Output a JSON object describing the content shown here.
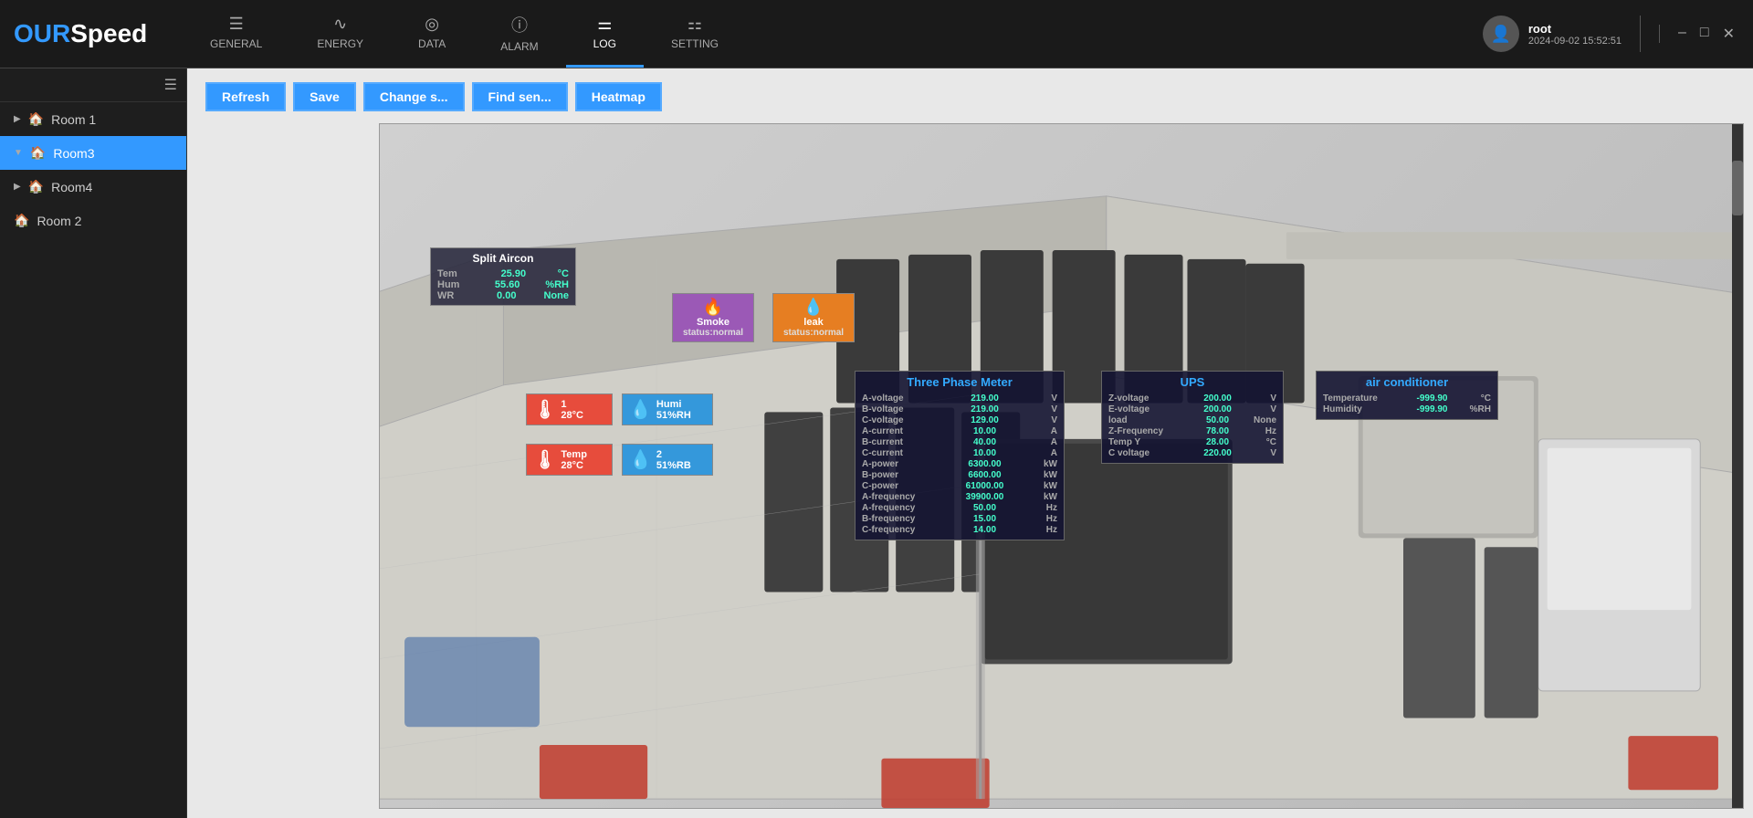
{
  "app": {
    "logo_our": "OUR",
    "logo_speed": "Speed"
  },
  "nav": {
    "items": [
      {
        "id": "general",
        "icon": "☰",
        "label": "GENERAL",
        "active": false
      },
      {
        "id": "energy",
        "icon": "∿",
        "label": "ENERGY",
        "active": false
      },
      {
        "id": "data",
        "icon": "◎",
        "label": "DATA",
        "active": false
      },
      {
        "id": "alarm",
        "icon": "ⓘ",
        "label": "ALARM",
        "active": false
      },
      {
        "id": "log",
        "icon": "⚌",
        "label": "LOG",
        "active": true
      },
      {
        "id": "setting",
        "icon": "⚏",
        "label": "SETTING",
        "active": false
      }
    ]
  },
  "user": {
    "name": "root",
    "datetime": "2024-09-02 15:52:51"
  },
  "toolbar": {
    "refresh": "Refresh",
    "save": "Save",
    "change_s": "Change s...",
    "find_sen": "Find sen...",
    "heatmap": "Heatmap"
  },
  "sidebar": {
    "items": [
      {
        "id": "room1",
        "label": "Room 1",
        "expanded": false,
        "active": false
      },
      {
        "id": "room3",
        "label": "Room3",
        "expanded": true,
        "active": true
      },
      {
        "id": "room4",
        "label": "Room4",
        "expanded": false,
        "active": false
      },
      {
        "id": "room2",
        "label": "Room 2",
        "expanded": false,
        "active": false
      }
    ]
  },
  "sensors": {
    "split_aircon": {
      "title": "Split Aircon",
      "rows": [
        {
          "label": "Tem",
          "value": "25.90",
          "unit": "°C"
        },
        {
          "label": "Hum",
          "value": "55.60",
          "unit": "%RH"
        },
        {
          "label": "WR",
          "value": "0.00",
          "unit": "None"
        }
      ]
    },
    "smoke": {
      "title": "Smoke",
      "status": "status:normal"
    },
    "leak": {
      "title": "leak",
      "status": "status:normal"
    },
    "temp1": {
      "label": "1",
      "value": "28°C"
    },
    "humi1": {
      "label": "Humi",
      "value": "51%RH"
    },
    "temp2": {
      "label": "Temp",
      "value": "28°C"
    },
    "humi2": {
      "label": "2",
      "value": "51%RB"
    },
    "three_phase": {
      "title": "Three Phase Meter",
      "rows": [
        {
          "label": "A-voltage",
          "value": "219.00",
          "unit": "V"
        },
        {
          "label": "B-voltage",
          "value": "219.00",
          "unit": "V"
        },
        {
          "label": "C-voltage",
          "value": "129.00",
          "unit": "V"
        },
        {
          "label": "A-current",
          "value": "10.00",
          "unit": "A"
        },
        {
          "label": "B-current",
          "value": "40.00",
          "unit": "A"
        },
        {
          "label": "C-current",
          "value": "10.00",
          "unit": "A"
        },
        {
          "label": "A-power",
          "value": "6300.00",
          "unit": "kW"
        },
        {
          "label": "B-power",
          "value": "6600.00",
          "unit": "kW"
        },
        {
          "label": "C-power",
          "value": "61000.00",
          "unit": "kW"
        },
        {
          "label": "A-frequency",
          "value": "39900.00",
          "unit": "kW"
        },
        {
          "label": "A-frequency",
          "value": "50.00",
          "unit": "Hz"
        },
        {
          "label": "B-frequency",
          "value": "15.00",
          "unit": "Hz"
        },
        {
          "label": "C-frequency",
          "value": "14.00",
          "unit": "Hz"
        }
      ]
    },
    "ups": {
      "title": "UPS",
      "rows": [
        {
          "label": "Z-voltage",
          "value": "200.00",
          "unit": "V"
        },
        {
          "label": "E-voltage",
          "value": "200.00",
          "unit": "V"
        },
        {
          "label": "load",
          "value": "50.00",
          "unit": "None"
        },
        {
          "label": "Z-Frequency",
          "value": "78.00",
          "unit": "Hz"
        },
        {
          "label": "Temp Y",
          "value": "28.00",
          "unit": "°C"
        },
        {
          "label": "C voltage",
          "value": "220.00",
          "unit": "V"
        }
      ]
    },
    "air_conditioner": {
      "title": "air conditioner",
      "rows": [
        {
          "label": "Temperature",
          "value": "-999.90",
          "unit": "°C"
        },
        {
          "label": "Humidity",
          "value": "-999.90",
          "unit": "%RH"
        }
      ]
    }
  }
}
